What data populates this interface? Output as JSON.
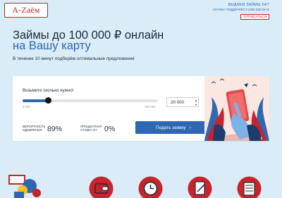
{
  "brand": {
    "logo_text": "A-Zаём",
    "color": "#c8242b"
  },
  "header": {
    "line1": "ВЫДАЕМ ЗАЙМЫ 24/7",
    "line2": "СЛУЖБА ПОДДЕРЖКИ 8 (495) 638-38-41",
    "unsubscribe": "ОТПИСАТЬСЯ"
  },
  "hero": {
    "title_line1": "Займы до 100 000 ₽ онлайн",
    "title_line2": "на Вашу карту",
    "subtitle": "В течение 10 минут подберём оптимальные предложения"
  },
  "form": {
    "question": "Возьмите сколько нужно!",
    "slider_min_label": "1 000",
    "slider_max_label": "100 000",
    "slider_value": 20000,
    "slider_min": 1000,
    "slider_max": 100000,
    "amount_value": "20 000",
    "stepper_up": "▲",
    "stepper_down": "▼",
    "approval_label_1": "ВЕРОЯТНОСТЬ",
    "approval_label_2": "ОДОБРЕНИЯ",
    "approval_value": "89%",
    "rate_label_1": "ПРОЦЕНТНАЯ",
    "rate_label_2": "СТАВКА ОТ",
    "rate_value": "0%",
    "submit_label": "Подать заявку",
    "submit_icon": "chevron-right-icon"
  },
  "colors": {
    "accent": "#2f67b2",
    "background": "#d9ecf8",
    "red": "#c8242b"
  }
}
